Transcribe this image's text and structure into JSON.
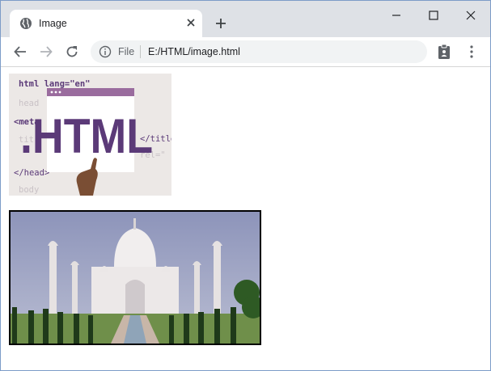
{
  "browser": {
    "tab": {
      "title": "Image",
      "icon": "globe-icon",
      "close_icon": "close-icon"
    },
    "new_tab_icon": "plus-icon",
    "window_controls": [
      "minimize-icon",
      "maximize-icon",
      "close-icon"
    ],
    "toolbar": {
      "back_icon": "arrow-left-icon",
      "forward_icon": "arrow-right-icon",
      "reload_icon": "reload-icon",
      "site_info_icon": "info-icon",
      "scheme_label": "File",
      "url": "E:/HTML/image.html",
      "extension_icon": "clipboard-icon",
      "menu_icon": "kebab-menu-icon"
    }
  },
  "page": {
    "image_html": {
      "logo_text": ".HTML",
      "code_lines": [
        "html lang=\"en\"",
        "head",
        "<meta",
        "tit",
        "</title",
        "rel=\"",
        "</head>",
        "body"
      ]
    },
    "image_taj": {
      "border_color": "#000000"
    }
  },
  "colors": {
    "titlebar": "#dee1e6",
    "omnibox": "#f1f3f4",
    "html_purple": "#5b3a78"
  }
}
